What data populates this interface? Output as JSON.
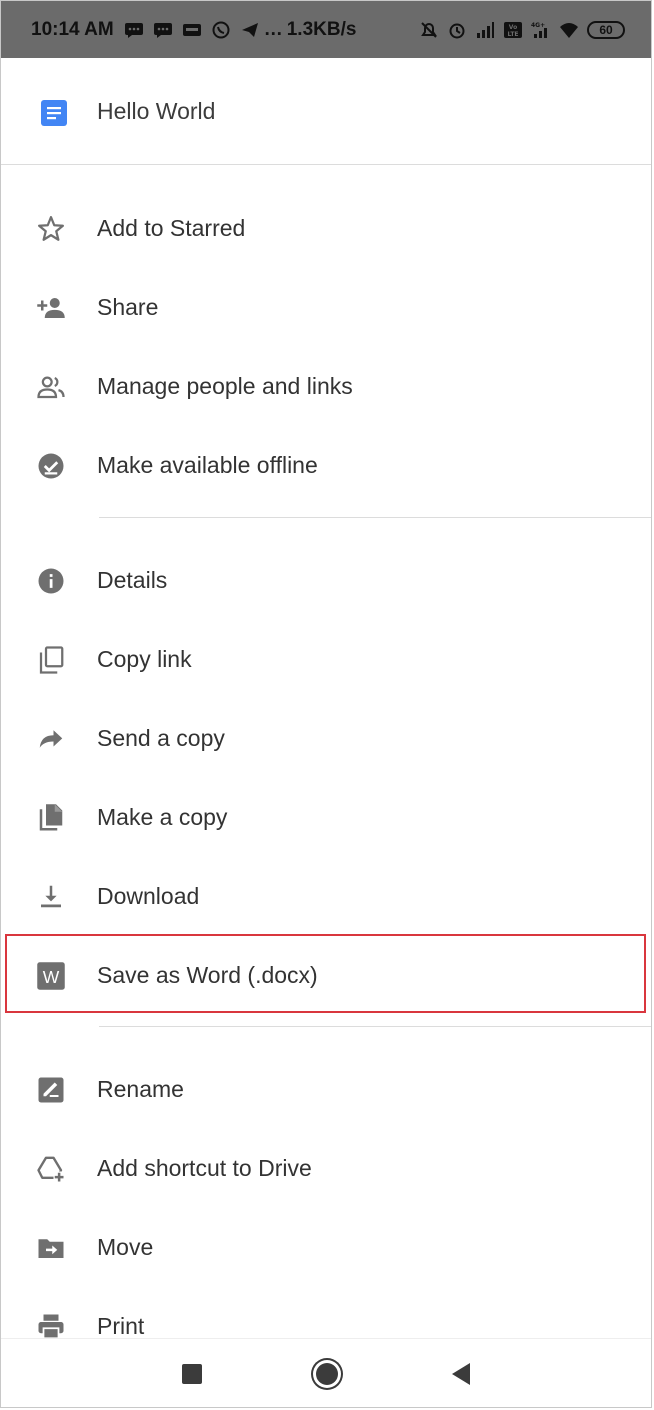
{
  "status_bar": {
    "time": "10:14 AM",
    "net_speed": "1.3KB/s",
    "dots": "…",
    "battery": "60",
    "left_icons": [
      "chat-icon",
      "message-icon",
      "voot-icon",
      "whatsapp-icon",
      "telegram-icon"
    ],
    "right_icons": [
      "mute-icon",
      "alarm-icon",
      "signal-icon",
      "volte-icon",
      "4g-signal-icon",
      "wifi-icon"
    ],
    "volte_label": "Vo LTE",
    "fourg_label": "4G+"
  },
  "document": {
    "title": "Hello World",
    "icon": "google-docs-icon",
    "icon_color": "#4285F4"
  },
  "menu": [
    {
      "id": "starred",
      "label": "Add to Starred",
      "icon": "star-outline-icon"
    },
    {
      "id": "share",
      "label": "Share",
      "icon": "person-add-icon"
    },
    {
      "id": "manage",
      "label": "Manage people and links",
      "icon": "people-icon"
    },
    {
      "id": "offline",
      "label": "Make available offline",
      "icon": "offline-check-icon"
    },
    {
      "id": "details",
      "label": "Details",
      "icon": "info-icon"
    },
    {
      "id": "copylink",
      "label": "Copy link",
      "icon": "copy-icon"
    },
    {
      "id": "sendcopy",
      "label": "Send a copy",
      "icon": "forward-arrow-icon"
    },
    {
      "id": "makecopy",
      "label": "Make a copy",
      "icon": "file-copy-icon"
    },
    {
      "id": "download",
      "label": "Download",
      "icon": "download-icon"
    },
    {
      "id": "saveword",
      "label": "Save as Word (.docx)",
      "icon": "word-icon",
      "icon_text": "W",
      "highlighted": true
    },
    {
      "id": "rename",
      "label": "Rename",
      "icon": "rename-icon"
    },
    {
      "id": "shortcut",
      "label": "Add shortcut to Drive",
      "icon": "add-shortcut-icon"
    },
    {
      "id": "move",
      "label": "Move",
      "icon": "move-folder-icon"
    },
    {
      "id": "print",
      "label": "Print",
      "icon": "print-icon"
    }
  ],
  "colors": {
    "status_bar": "#6b6b6b",
    "highlight": "#d9363e",
    "icon_gray": "#6f6f6f"
  },
  "nav_bar": [
    "recents-square-icon",
    "home-circle-icon",
    "back-triangle-icon"
  ]
}
